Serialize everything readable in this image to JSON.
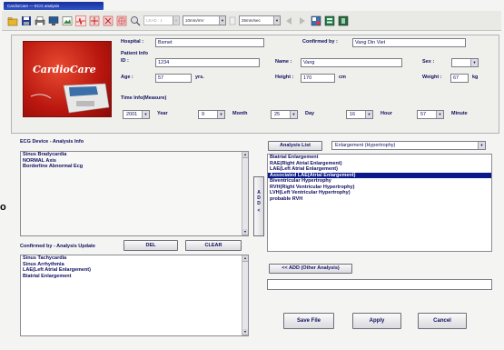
{
  "window": {
    "title": "CardioCare — ECG analysis"
  },
  "toolbar": {
    "lead_select": "LEAD : 1",
    "speed_select": "10mm/mV",
    "time_select": "25mm/sec"
  },
  "patient": {
    "hospital_label": "Hospital :",
    "hospital_value": "Bsmet",
    "confirmed_label": "Confirmed by :",
    "confirmed_value": "Vang Din Viet",
    "info_heading": "Patient Info",
    "id_label": "ID :",
    "id_value": "1234",
    "name_label": "Name :",
    "name_value": "Vang",
    "sex_label": "Sex :",
    "sex_value": "",
    "age_label": "Age :",
    "age_value": "57",
    "age_unit": "yrs.",
    "height_label": "Height :",
    "height_value": "170",
    "height_unit": "cm",
    "weight_label": "Weight :",
    "weight_value": "67",
    "weight_unit": "kg"
  },
  "device": {
    "brand": "CardioCare"
  },
  "time_info": {
    "heading": "Time Info(Measure)",
    "year_value": "2001",
    "year_label": "Year",
    "month_value": "9",
    "month_label": "Month",
    "day_value": "25",
    "day_label": "Day",
    "hour_value": "16",
    "hour_label": "Hour",
    "minute_value": "57",
    "minute_label": "Minute"
  },
  "ecg_info": {
    "heading": "ECG Device - Analysis Info",
    "lines": [
      "Sinus Bradycardia",
      "NORMAL Axis",
      "Borderline Abnormal Ecg"
    ]
  },
  "confirmed_update": {
    "heading": "Confirmed by - Analysis Update",
    "del_label": "DEL",
    "clear_label": "CLEAR",
    "lines": [
      "Sinus Tachycardia",
      "Sinus Arrhythmia",
      "LAE(Left Atrial Enlargement)",
      "Biatrial Enlargement"
    ]
  },
  "analysis_list": {
    "button_label": "Analysis List",
    "category_value": "Enlargement (Hypertrophy)",
    "items": [
      "Biatrial Enlargement",
      "RAE(Right Atrial Enlargement)",
      "LAE(Left Atrial Enlargement)",
      "Associated LAE(Atrial Enlargement)",
      "Biventricular Hypertrophy",
      "RVH(Right Ventricular Hypertrophy)",
      "LVH(Left Ventricular Hypertrophy)",
      "probable RVH"
    ],
    "selected_index": 3
  },
  "add_bar": {
    "label": "ADD",
    "arrow": "<"
  },
  "add_other": {
    "button_label": "<< ADD (Other Analysis)",
    "input_value": ""
  },
  "footer": {
    "save_label": "Save File",
    "apply_label": "Apply",
    "cancel_label": "Cancel"
  },
  "side_marker": "o",
  "colors": {
    "title_bar": "#2438a8",
    "selection": "#0a1a8a",
    "device_red": "#c81a12",
    "text": "#101060"
  }
}
